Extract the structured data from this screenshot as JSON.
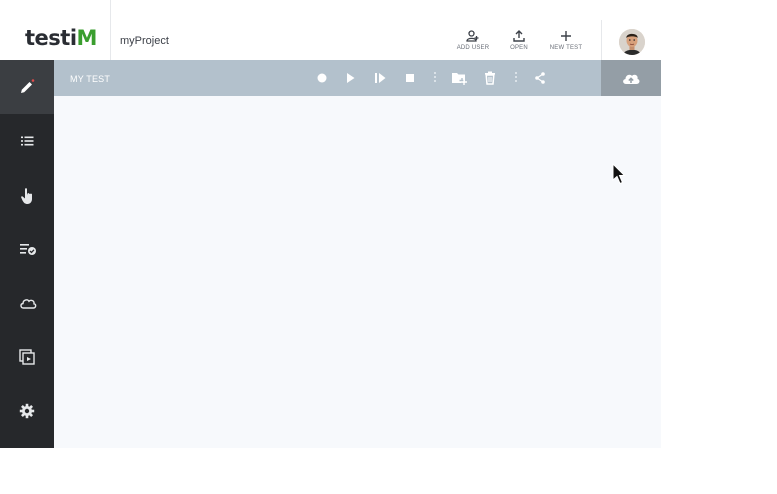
{
  "header": {
    "logo_text": "testi",
    "logo_mark": "M",
    "project_name": "myProject",
    "buttons": [
      {
        "label": "ADD USER",
        "icon": "add-user-icon"
      },
      {
        "label": "OPEN",
        "icon": "upload-icon"
      },
      {
        "label": "NEW TEST",
        "icon": "plus-icon"
      }
    ],
    "avatar": "user-avatar"
  },
  "toolbar": {
    "test_name": "MY TEST",
    "icons": [
      "record-icon",
      "play-icon",
      "step-forward-icon",
      "stop-icon",
      "kebab-icon",
      "add-folder-icon",
      "trash-icon",
      "kebab-icon",
      "share-icon",
      "cloud-upload-icon"
    ]
  },
  "sidebar": {
    "items": [
      {
        "icon": "edit-icon",
        "active": true
      },
      {
        "icon": "list-icon"
      },
      {
        "icon": "hand-pointer-icon"
      },
      {
        "icon": "checklist-icon"
      },
      {
        "icon": "cloud-icon"
      },
      {
        "icon": "window-icon"
      },
      {
        "icon": "gear-icon"
      }
    ]
  },
  "colors": {
    "sidebar_bg": "#26282b",
    "toolbar_bg": "#b3c1cc",
    "accent": "#3a9e2e",
    "canvas_bg": "#f7f9fc"
  }
}
